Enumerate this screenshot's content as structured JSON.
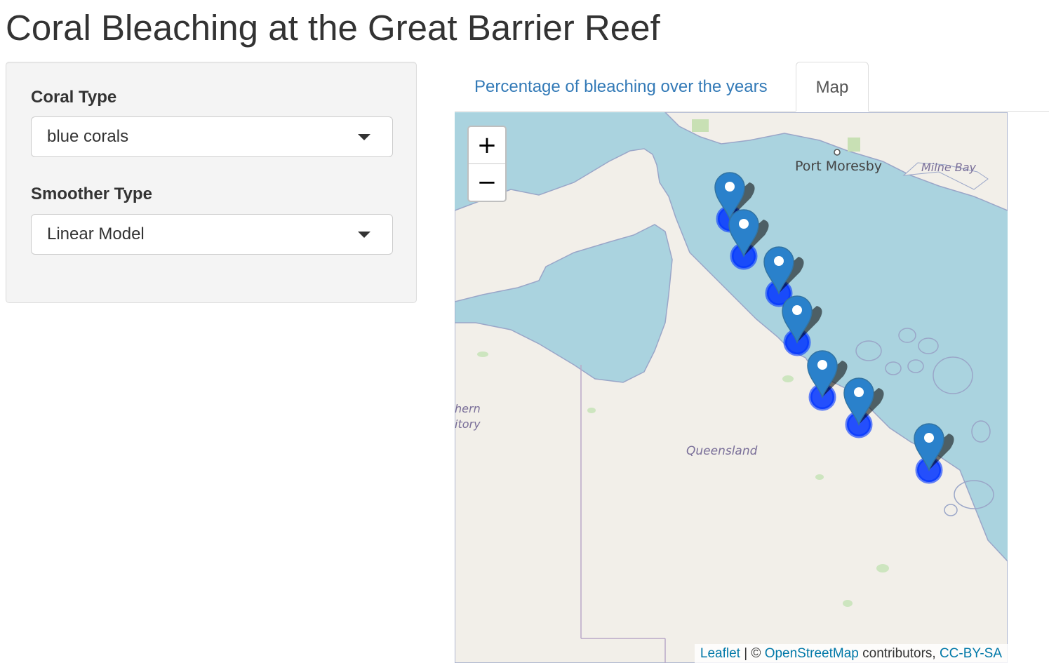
{
  "page": {
    "title": "Coral Bleaching at the Great Barrier Reef"
  },
  "sidebar": {
    "coral_type": {
      "label": "Coral Type",
      "value": "blue corals"
    },
    "smoother_type": {
      "label": "Smoother Type",
      "value": "Linear Model"
    }
  },
  "tabs": [
    {
      "label": "Percentage of bleaching over the years",
      "active": false
    },
    {
      "label": "Map",
      "active": true
    }
  ],
  "map": {
    "zoom_in": "+",
    "zoom_out": "−",
    "place_labels": {
      "port_moresby": "Port Moresby",
      "milne_bay": "Milne Bay",
      "queensland": "Queensland",
      "northern_territory_1": "hern",
      "northern_territory_2": "itory"
    },
    "marker_count": 7,
    "marker_color": "#2a81cb",
    "circle_color": "#0033ff",
    "attribution": {
      "leaflet": "Leaflet",
      "separator": " | © ",
      "osm": "OpenStreetMap",
      "contributors": " contributors, ",
      "license": "CC-BY-SA"
    }
  },
  "colors": {
    "water": "#aad3df",
    "land": "#f2efe9",
    "link": "#337ab7"
  }
}
